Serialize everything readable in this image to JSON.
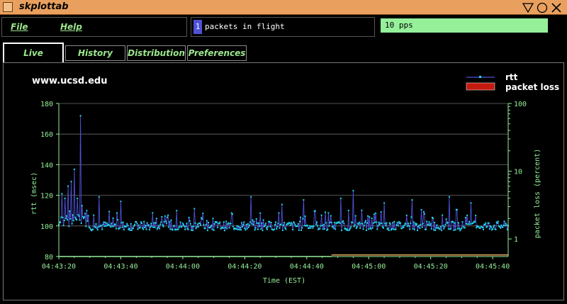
{
  "window": {
    "title": "skplottab"
  },
  "menu": {
    "file": "File",
    "help": "Help"
  },
  "status": {
    "packets_in_flight_count": "1",
    "packets_in_flight_label": "packets in flight",
    "rate": "10 pps"
  },
  "tabs": [
    {
      "label": "Live",
      "active": true
    },
    {
      "label": "History",
      "active": false
    },
    {
      "label": "Distribution",
      "active": false
    },
    {
      "label": "Preferences",
      "active": false
    }
  ],
  "colors": {
    "titlebar": "#e9a05e",
    "axis": "#96f09a",
    "rtt_line": "#4f52d8",
    "rtt_marker": "#22d6ee",
    "packet_loss": "#c41a10",
    "rate_box": "#96f09a"
  },
  "chart_data": {
    "type": "line",
    "title": "www.ucsd.edu",
    "xlabel": "Time (EST)",
    "ylabel": "rtt (msec)",
    "y2label": "packet loss (percent)",
    "x_ticks": [
      "04:43:20",
      "04:43:40",
      "04:44:00",
      "04:44:20",
      "04:44:40",
      "04:45:00",
      "04:45:20",
      "04:45:40"
    ],
    "x_range_seconds_from_first_tick": [
      0,
      145
    ],
    "ylim": [
      80,
      180
    ],
    "y_ticks": [
      80,
      100,
      120,
      140,
      160,
      180
    ],
    "y2_scale": "log",
    "y2_ticks": [
      1,
      10,
      100
    ],
    "y2lim": [
      0.55,
      100
    ],
    "grid": true,
    "legend_position": "top-right",
    "series": [
      {
        "name": "rtt",
        "summary": {
          "baseline": 100,
          "typical_min": 96,
          "typical_max": 112,
          "peak": 172,
          "peak_time": "04:43:27"
        },
        "peaks": [
          {
            "t": 1,
            "v": 121
          },
          {
            "t": 2,
            "v": 118
          },
          {
            "t": 3,
            "v": 126
          },
          {
            "t": 4,
            "v": 129
          },
          {
            "t": 5,
            "v": 137
          },
          {
            "t": 6,
            "v": 118
          },
          {
            "t": 7,
            "v": 172
          },
          {
            "t": 9,
            "v": 110
          },
          {
            "t": 13,
            "v": 119
          },
          {
            "t": 20,
            "v": 116
          },
          {
            "t": 38,
            "v": 110
          },
          {
            "t": 62,
            "v": 119
          },
          {
            "t": 72,
            "v": 114
          },
          {
            "t": 79,
            "v": 117
          },
          {
            "t": 91,
            "v": 118
          },
          {
            "t": 95,
            "v": 123
          },
          {
            "t": 105,
            "v": 115
          },
          {
            "t": 114,
            "v": 117
          },
          {
            "t": 126,
            "v": 119
          },
          {
            "t": 133,
            "v": 115
          }
        ]
      },
      {
        "name": "packet loss",
        "segments": [
          {
            "t_start": 0,
            "t_end": 88,
            "v": 0.55
          },
          {
            "t_start": 88,
            "t_end": 145,
            "v": 0.58
          }
        ]
      }
    ]
  }
}
